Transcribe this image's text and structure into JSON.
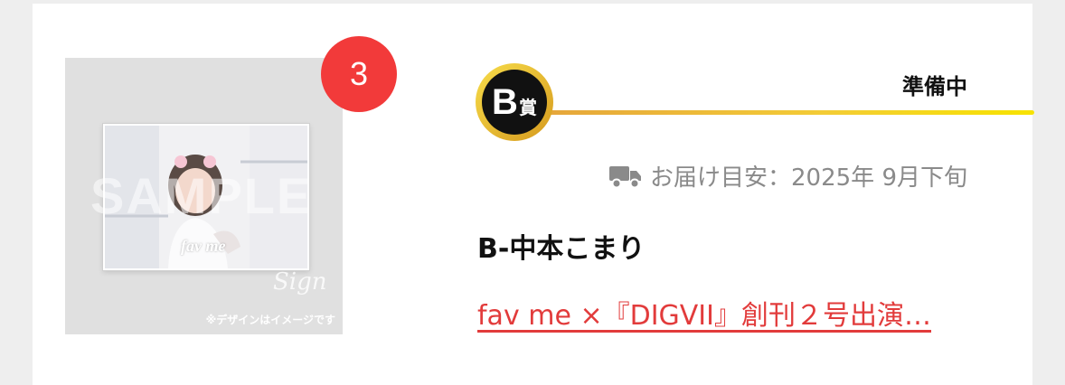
{
  "item": {
    "rank": "3",
    "prize_letter": "B",
    "prize_kanji": "賞",
    "status": "準備中",
    "delivery_label": "お届け目安：2025年 9月下旬",
    "name": "B-中本こまり",
    "link_text": "fav me ×『DIGVII』創刊２号出演…",
    "image_note": "※デザインはイメージです",
    "image_logo": "fav me",
    "image_watermark": "SAMPLE",
    "image_sign": "Sign",
    "icons": [
      "truck-icon"
    ],
    "colors": {
      "rank_badge": "#f23a3a",
      "link": "#e23b3b",
      "prize_gold": "#f3cc36"
    }
  }
}
